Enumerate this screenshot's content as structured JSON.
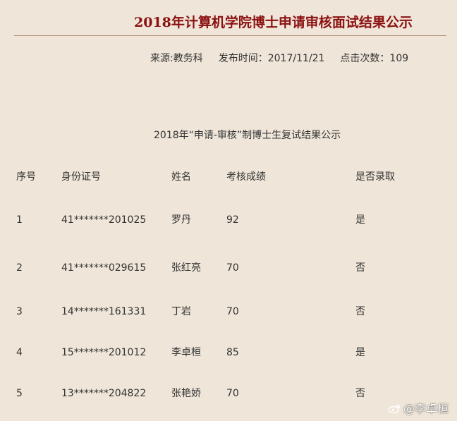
{
  "header": {
    "title": "2018年计算机学院博士申请审核面试结果公示"
  },
  "meta": {
    "source": "来源:教务科",
    "published": "发布时间：2017/11/21",
    "clicks": "点击次数：109"
  },
  "subtitle": "2018年“申请-审核”制博士生复试结果公示",
  "table": {
    "headers": [
      "序号",
      "身份证号",
      "姓名",
      "考核成绩",
      "是否录取"
    ],
    "rows": [
      [
        "1",
        "41*******201025",
        "罗丹",
        "92",
        "是"
      ],
      [
        "2",
        "41*******029615",
        "张红亮",
        "70",
        "否"
      ],
      [
        "3",
        "14*******161331",
        "丁岩",
        "70",
        "否"
      ],
      [
        "4",
        "15*******201012",
        "李卓桓",
        "85",
        "是"
      ],
      [
        "5",
        "13*******204822",
        "张艳娇",
        "70",
        "否"
      ]
    ]
  },
  "watermark": {
    "text": "@李卓桓",
    "icon": "weibo-logo"
  }
}
